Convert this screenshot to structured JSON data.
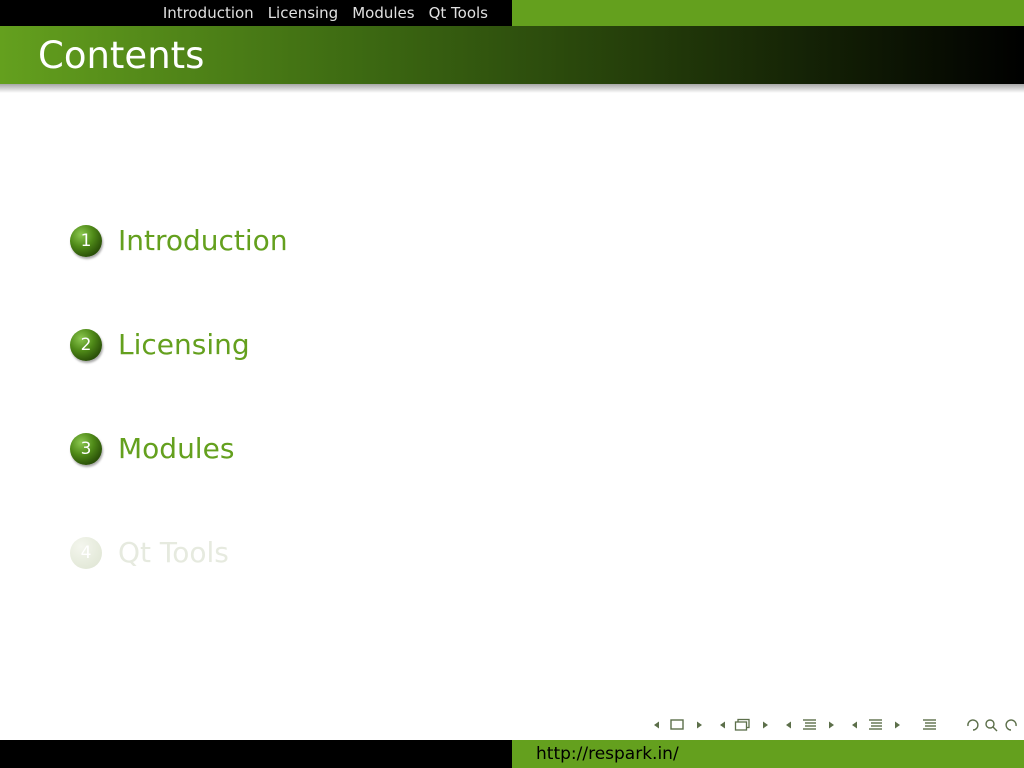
{
  "nav": {
    "sections": [
      "Introduction",
      "Licensing",
      "Modules",
      "Qt Tools"
    ]
  },
  "frame": {
    "title": "Contents"
  },
  "toc": {
    "items": [
      {
        "number": "1",
        "label": "Introduction"
      },
      {
        "number": "2",
        "label": "Licensing"
      },
      {
        "number": "3",
        "label": "Modules"
      },
      {
        "number": "4",
        "label": "Qt Tools"
      }
    ]
  },
  "footer": {
    "url": "http://respark.in/"
  },
  "colors": {
    "accent": "#64a01e",
    "bar": "#000000",
    "faded": "#e6eadf"
  },
  "icons": {
    "nav_symbols": [
      "frame-prev-icon",
      "frame-icon",
      "frame-next-icon",
      "slide-prev-icon",
      "slide-icon",
      "slide-next-icon",
      "subsection-prev-icon",
      "subsection-icon",
      "subsection-next-icon",
      "section-prev-icon",
      "section-icon",
      "section-next-icon",
      "document-icon",
      "undo-icon",
      "search-icon",
      "redo-icon"
    ]
  }
}
